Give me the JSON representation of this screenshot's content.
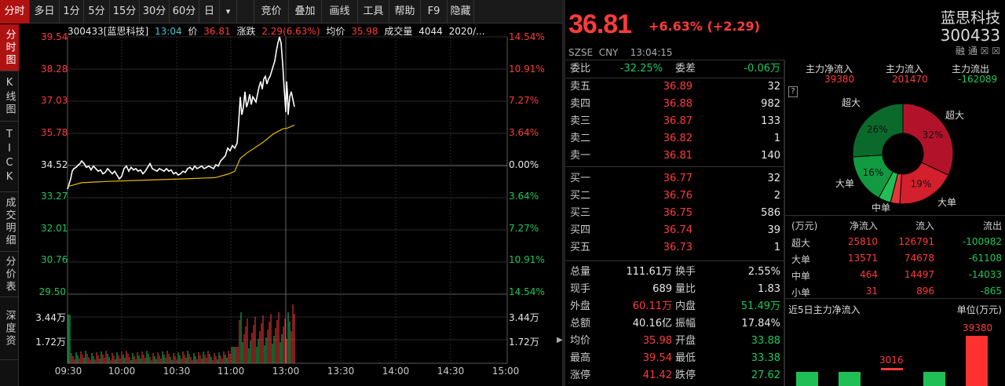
{
  "toolbar": {
    "items": [
      "分时",
      "多日",
      "1分",
      "5分",
      "15分",
      "30分",
      "60分",
      "日",
      "竞价",
      "叠加",
      "画线",
      "工具",
      "帮助",
      "F9",
      "隐藏"
    ],
    "dropdown_glyph": "▾"
  },
  "side_tabs": [
    "分时图",
    "K线图",
    "TICK",
    "成交明细",
    "分价表",
    "深度资"
  ],
  "chart": {
    "info": {
      "code_name": "300433[蓝思科技]",
      "time": "13:04",
      "price_label": "价",
      "price": "36.81",
      "change_label": "涨跌",
      "change": "2.29(6.63%)",
      "avg_label": "均价",
      "avg": "35.98",
      "vol_label": "成交量",
      "vol": "4044",
      "date": "2020/..."
    },
    "price_ticks_left": [
      "39.54",
      "38.28",
      "37.03",
      "35.78",
      "34.52",
      "33.27",
      "32.01",
      "30.76"
    ],
    "pct_ticks_right": [
      "14.54%",
      "10.91%",
      "7.27%",
      "3.64%",
      "0.00%",
      "3.64%",
      "7.27%",
      "10.91%"
    ],
    "vol_ticks_left": [
      "29.50",
      "3.44万",
      "1.72万"
    ],
    "vol_ticks_right": [
      "14.54%",
      "3.44万",
      "1.72万"
    ],
    "time_ticks": [
      "09:30",
      "10:00",
      "10:30",
      "11:00",
      "13:00",
      "13:30",
      "14:00",
      "14:30",
      "15:00"
    ],
    "colors": {
      "price_line": "#ffffff",
      "avg_line": "#e5b800",
      "up": "#ff3b3b",
      "down": "#19c95b"
    }
  },
  "quote": {
    "price": "36.81",
    "change": "+6.63% (+2.29)",
    "name": "蓝思科技",
    "code": "300433",
    "market": "SZSE",
    "currency": "CNY",
    "time": "13:04:15",
    "icons": "融 通 ☒ ☒"
  },
  "orderbook": {
    "weibi_label": "委比",
    "weibi": "-32.25%",
    "weicha_label": "委差",
    "weicha": "-0.06万",
    "asks": [
      {
        "label": "卖五",
        "price": "36.89",
        "vol": "32"
      },
      {
        "label": "卖四",
        "price": "36.88",
        "vol": "982"
      },
      {
        "label": "卖三",
        "price": "36.87",
        "vol": "133"
      },
      {
        "label": "卖二",
        "price": "36.82",
        "vol": "1"
      },
      {
        "label": "卖一",
        "price": "36.81",
        "vol": "140"
      }
    ],
    "bids": [
      {
        "label": "买一",
        "price": "36.77",
        "vol": "32"
      },
      {
        "label": "买二",
        "price": "36.76",
        "vol": "2"
      },
      {
        "label": "买三",
        "price": "36.75",
        "vol": "586"
      },
      {
        "label": "买四",
        "price": "36.74",
        "vol": "39"
      },
      {
        "label": "买五",
        "price": "36.73",
        "vol": "1"
      }
    ]
  },
  "stats": [
    {
      "l1": "总量",
      "v1": "111.61万",
      "c1": "white",
      "l2": "换手",
      "v2": "2.55%",
      "c2": "white"
    },
    {
      "l1": "现手",
      "v1": "689",
      "c1": "white",
      "l2": "量比",
      "v2": "1.83",
      "c2": "white"
    },
    {
      "l1": "外盘",
      "v1": "60.11万",
      "c1": "red",
      "l2": "内盘",
      "v2": "51.49万",
      "c2": "green"
    },
    {
      "l1": "总额",
      "v1": "40.16亿",
      "c1": "white",
      "l2": "振幅",
      "v2": "17.84%",
      "c2": "white"
    },
    {
      "l1": "均价",
      "v1": "35.98",
      "c1": "red",
      "l2": "开盘",
      "v2": "33.88",
      "c2": "green"
    },
    {
      "l1": "最高",
      "v1": "39.54",
      "c1": "red",
      "l2": "最低",
      "v2": "33.38",
      "c2": "green"
    },
    {
      "l1": "涨停",
      "v1": "41.42",
      "c1": "red",
      "l2": "跌停",
      "v2": "27.62",
      "c2": "green"
    }
  ],
  "flow": {
    "help": "?",
    "summary": [
      {
        "label": "主力净流入",
        "value": "39380",
        "color": "red"
      },
      {
        "label": "主力流入",
        "value": "201470",
        "color": "red"
      },
      {
        "label": "主力流出",
        "value": "-162089",
        "color": "green"
      }
    ],
    "donut": {
      "labels": {
        "super": "超大",
        "big": "大单",
        "mid": "中单"
      },
      "slices": [
        {
          "name": "超大流入",
          "pct": 32,
          "color": "#b3132a",
          "label": "32%"
        },
        {
          "name": "大单流入",
          "pct": 19,
          "color": "#d41f2d",
          "label": "19%"
        },
        {
          "name": "中单流入",
          "pct": 3,
          "color": "#e8353c",
          "label": ""
        },
        {
          "name": "中单流出",
          "pct": 4,
          "color": "#1fbf55",
          "label": ""
        },
        {
          "name": "大单流出",
          "pct": 16,
          "color": "#119a40",
          "label": "16%"
        },
        {
          "name": "超大流出",
          "pct": 26,
          "color": "#0b6a2b",
          "label": "26%"
        }
      ]
    },
    "table_head": [
      "(万元)",
      "净流入",
      "流入",
      "流出"
    ],
    "table": [
      {
        "k": "超大",
        "net": "25810",
        "in": "126791",
        "out": "-100982"
      },
      {
        "k": "大单",
        "net": "13571",
        "in": "74678",
        "out": "-61108"
      },
      {
        "k": "中单",
        "net": "464",
        "in": "14497",
        "out": "-14033"
      },
      {
        "k": "小单",
        "net": "31",
        "in": "896",
        "out": "-865"
      }
    ],
    "five_day_title": "近5日主力净流入",
    "unit_label": "单位(万元)",
    "five_day": {
      "values_shown": [
        "3016",
        "39380"
      ]
    }
  }
}
